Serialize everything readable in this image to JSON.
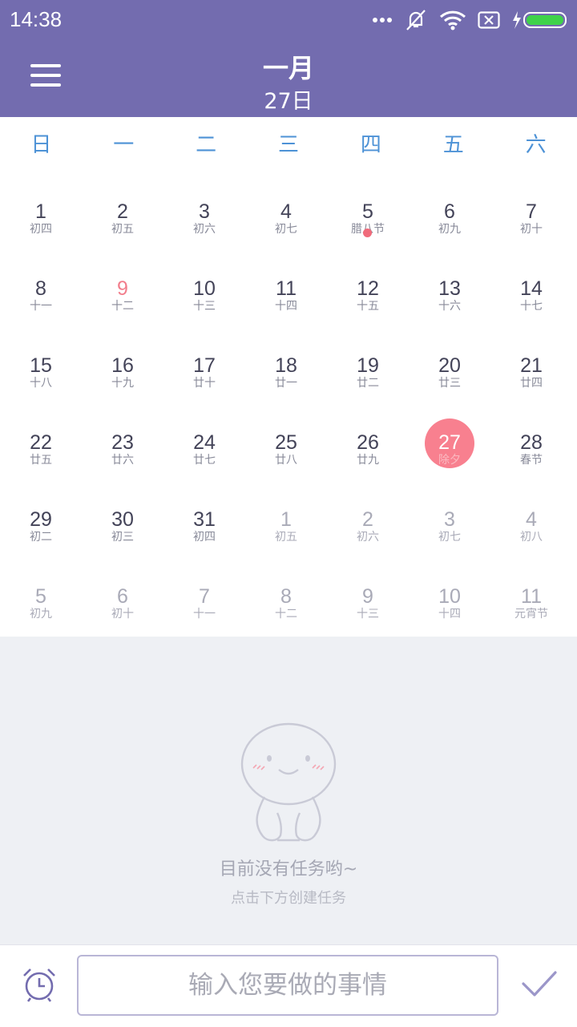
{
  "status_bar": {
    "time": "14:38"
  },
  "header": {
    "month": "一月",
    "day": "27日"
  },
  "weekdays": [
    "日",
    "一",
    "二",
    "三",
    "四",
    "五",
    "六"
  ],
  "calendar": {
    "rows": [
      [
        {
          "num": "1",
          "lunar": "初四"
        },
        {
          "num": "2",
          "lunar": "初五"
        },
        {
          "num": "3",
          "lunar": "初六"
        },
        {
          "num": "4",
          "lunar": "初七"
        },
        {
          "num": "5",
          "lunar": "腊八节",
          "event_dot": true
        },
        {
          "num": "6",
          "lunar": "初九"
        },
        {
          "num": "7",
          "lunar": "初十"
        }
      ],
      [
        {
          "num": "8",
          "lunar": "十一"
        },
        {
          "num": "9",
          "lunar": "十二",
          "holiday": true
        },
        {
          "num": "10",
          "lunar": "十三"
        },
        {
          "num": "11",
          "lunar": "十四"
        },
        {
          "num": "12",
          "lunar": "十五"
        },
        {
          "num": "13",
          "lunar": "十六"
        },
        {
          "num": "14",
          "lunar": "十七"
        }
      ],
      [
        {
          "num": "15",
          "lunar": "十八"
        },
        {
          "num": "16",
          "lunar": "十九"
        },
        {
          "num": "17",
          "lunar": "廿十"
        },
        {
          "num": "18",
          "lunar": "廿一"
        },
        {
          "num": "19",
          "lunar": "廿二"
        },
        {
          "num": "20",
          "lunar": "廿三"
        },
        {
          "num": "21",
          "lunar": "廿四"
        }
      ],
      [
        {
          "num": "22",
          "lunar": "廿五"
        },
        {
          "num": "23",
          "lunar": "廿六"
        },
        {
          "num": "24",
          "lunar": "廿七"
        },
        {
          "num": "25",
          "lunar": "廿八"
        },
        {
          "num": "26",
          "lunar": "廿九"
        },
        {
          "num": "27",
          "lunar": "除夕",
          "today": true
        },
        {
          "num": "28",
          "lunar": "春节"
        }
      ],
      [
        {
          "num": "29",
          "lunar": "初二"
        },
        {
          "num": "30",
          "lunar": "初三"
        },
        {
          "num": "31",
          "lunar": "初四"
        },
        {
          "num": "1",
          "lunar": "初五",
          "other": true
        },
        {
          "num": "2",
          "lunar": "初六",
          "other": true
        },
        {
          "num": "3",
          "lunar": "初七",
          "other": true
        },
        {
          "num": "4",
          "lunar": "初八",
          "other": true
        }
      ],
      [
        {
          "num": "5",
          "lunar": "初九",
          "other": true
        },
        {
          "num": "6",
          "lunar": "初十",
          "other": true
        },
        {
          "num": "7",
          "lunar": "十一",
          "other": true
        },
        {
          "num": "8",
          "lunar": "十二",
          "other": true
        },
        {
          "num": "9",
          "lunar": "十三",
          "other": true
        },
        {
          "num": "10",
          "lunar": "十四",
          "other": true
        },
        {
          "num": "11",
          "lunar": "元宵节",
          "other": true
        }
      ]
    ]
  },
  "empty_state": {
    "title": "目前没有任务哟~",
    "subtitle": "点击下方创建任务"
  },
  "bottom_bar": {
    "input_placeholder": "输入您要做的事情",
    "input_value": ""
  },
  "colors": {
    "header": "#736caf",
    "weekday": "#4d92d6",
    "today": "#f8808f",
    "holiday": "#f27e8c"
  },
  "icons": {
    "alarm": "alarm-clock-icon",
    "confirm": "checkmark-icon",
    "menu": "hamburger-menu-icon"
  }
}
